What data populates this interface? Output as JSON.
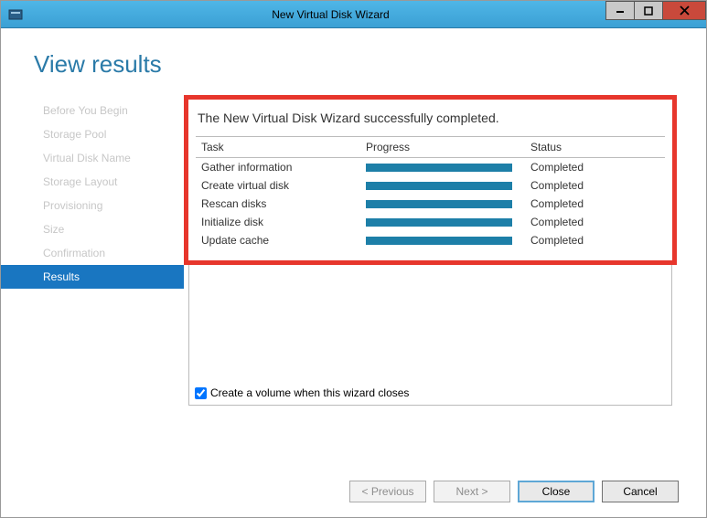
{
  "window": {
    "title": "New Virtual Disk Wizard"
  },
  "heading": "View results",
  "nav": {
    "items": [
      {
        "label": "Before You Begin"
      },
      {
        "label": "Storage Pool"
      },
      {
        "label": "Virtual Disk Name"
      },
      {
        "label": "Storage Layout"
      },
      {
        "label": "Provisioning"
      },
      {
        "label": "Size"
      },
      {
        "label": "Confirmation"
      },
      {
        "label": "Results"
      }
    ]
  },
  "results": {
    "message": "The New Virtual Disk Wizard successfully completed.",
    "columns": {
      "task": "Task",
      "progress": "Progress",
      "status": "Status"
    },
    "rows": [
      {
        "task": "Gather information",
        "status": "Completed"
      },
      {
        "task": "Create virtual disk",
        "status": "Completed"
      },
      {
        "task": "Rescan disks",
        "status": "Completed"
      },
      {
        "task": "Initialize disk",
        "status": "Completed"
      },
      {
        "task": "Update cache",
        "status": "Completed"
      }
    ]
  },
  "checkbox": {
    "label": "Create a volume when this wizard closes"
  },
  "buttons": {
    "previous": "< Previous",
    "next": "Next >",
    "close": "Close",
    "cancel": "Cancel"
  }
}
